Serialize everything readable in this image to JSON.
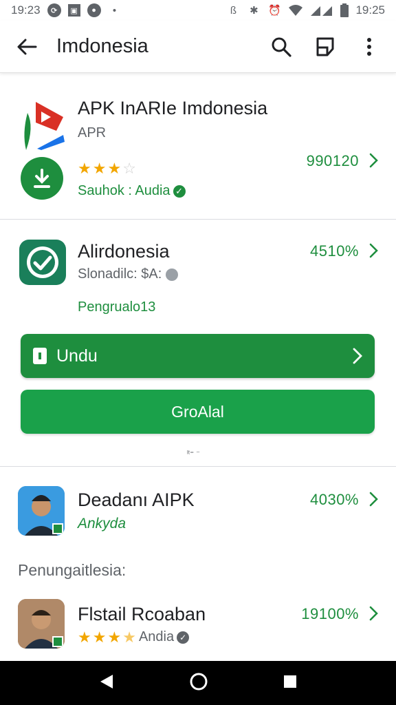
{
  "status_bar": {
    "time_left": "19:23",
    "time_right": "19:25"
  },
  "app_bar": {
    "title": "Imdonesia"
  },
  "item1": {
    "name": "APK InARIe Imdonesia",
    "subtitle": "APR",
    "rating_stars": 3,
    "rating_out_of": 5,
    "meta": "Sauhok : Audia",
    "count": "990120"
  },
  "item2": {
    "name": "Alirdonesia",
    "subtitle": "Slonadilc: $A:",
    "pct": "4510%",
    "note": "Pengrualo13",
    "download_button": "Undu",
    "secondary_button": "GroAlal",
    "tiny_text": "ᴵᵗ⁼ ⁻"
  },
  "item3": {
    "name": "Deadanı AIPK",
    "subtitle": "Ankyda",
    "pct": "4030%"
  },
  "section_label": "Penungaitlesia:",
  "item4": {
    "name": "Flstail Rcoaban",
    "rating_stars": 3.5,
    "rating_out_of": 5,
    "meta": "Andia",
    "pct": "19100%"
  },
  "colors": {
    "accent_green": "#1e8e3e",
    "button_green": "#1aa14a",
    "star": "#f2a600"
  }
}
